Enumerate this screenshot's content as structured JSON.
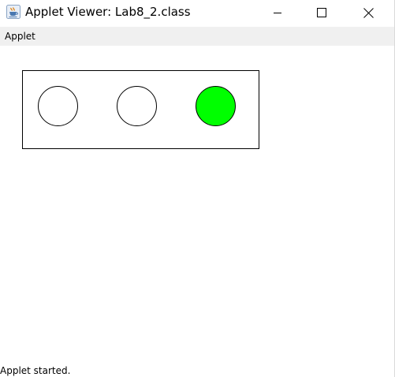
{
  "window": {
    "title": "Applet Viewer: Lab8_2.class",
    "icon": "java-cup-icon",
    "controls": [
      "minimize-icon",
      "maximize-icon",
      "close-icon"
    ]
  },
  "menu": {
    "items": [
      {
        "label": "Applet"
      }
    ]
  },
  "traffic_light": {
    "lamps": [
      {
        "state": "off",
        "color": "#ffffff"
      },
      {
        "state": "off",
        "color": "#ffffff"
      },
      {
        "state": "on",
        "color": "#00ff00"
      }
    ]
  },
  "status": {
    "text": "Applet started."
  }
}
